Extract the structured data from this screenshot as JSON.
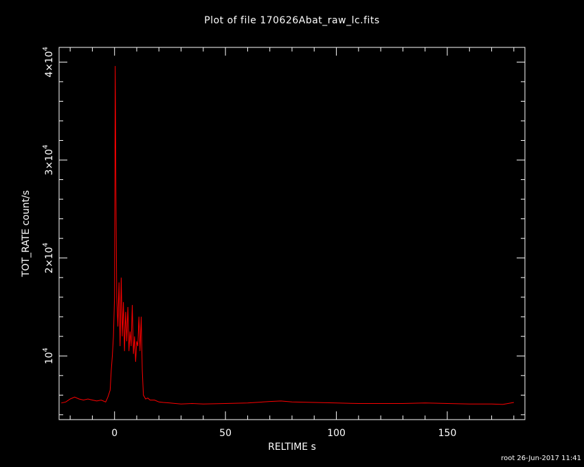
{
  "footer": "root 26-Jun-2017 11:41",
  "chart_data": {
    "type": "line",
    "title": "Plot of file 170626Abat_raw_lc.fits",
    "xlabel": "RELTIME  s",
    "ylabel": "TOT_RATE  count/s",
    "xlim": [
      -25,
      185
    ],
    "ylim": [
      3500,
      41500
    ],
    "xticks": [
      0,
      50,
      100,
      150
    ],
    "xtick_labels": [
      "0",
      "50",
      "100",
      "150"
    ],
    "yticks": [
      10000,
      20000,
      30000,
      40000
    ],
    "ytick_labels": [
      {
        "base": "10",
        "exp": "4"
      },
      {
        "base": "2×10",
        "exp": "4"
      },
      {
        "base": "3×10",
        "exp": "4"
      },
      {
        "base": "4×10",
        "exp": "4"
      }
    ],
    "grid": false,
    "colors": {
      "line": "#ff0000",
      "axes": "#ffffff",
      "background": "#000000"
    },
    "series": [
      {
        "x": [
          -24,
          -22,
          -20,
          -18,
          -16,
          -14,
          -12,
          -10,
          -8,
          -6,
          -4,
          -3,
          -2,
          -1.5,
          -1,
          -0.5,
          0,
          0.3,
          0.6,
          1,
          1.5,
          2,
          2.5,
          3,
          3.5,
          4,
          4.5,
          5,
          5.5,
          6,
          6.5,
          7,
          7.5,
          8,
          8.5,
          9,
          9.5,
          10,
          10.5,
          11,
          11.5,
          12,
          12.5,
          13,
          14,
          15,
          16,
          18,
          20,
          22,
          25,
          30,
          35,
          40,
          50,
          60,
          70,
          75,
          80,
          90,
          100,
          110,
          120,
          130,
          140,
          150,
          160,
          170,
          175,
          180
        ],
        "y": [
          5200,
          5300,
          5600,
          5800,
          5600,
          5500,
          5600,
          5500,
          5400,
          5500,
          5300,
          5800,
          6500,
          8500,
          10000,
          12000,
          16000,
          39600,
          27000,
          16000,
          13000,
          17500,
          11000,
          18000,
          12000,
          15500,
          10500,
          14500,
          11500,
          15000,
          10500,
          12500,
          11000,
          15200,
          10200,
          12000,
          9400,
          11500,
          11000,
          14000,
          10500,
          14000,
          8500,
          6000,
          5600,
          5700,
          5500,
          5500,
          5300,
          5250,
          5200,
          5100,
          5150,
          5100,
          5150,
          5200,
          5350,
          5400,
          5300,
          5250,
          5200,
          5150,
          5150,
          5150,
          5200,
          5150,
          5100,
          5100,
          5050,
          5250
        ]
      }
    ]
  }
}
